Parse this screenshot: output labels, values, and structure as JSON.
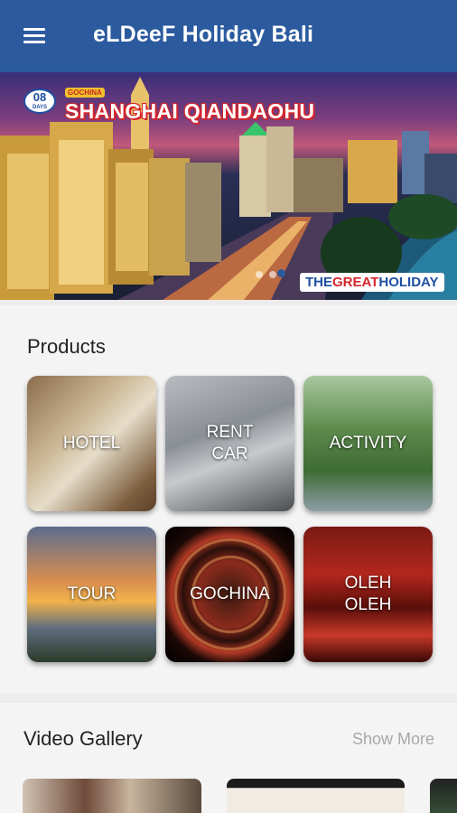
{
  "app_bar": {
    "title": "eLDeeF Holiday Bali",
    "menu_icon": "hamburger-menu-icon",
    "background": "#2b5a9e"
  },
  "banner": {
    "days_number": "08",
    "days_label": "DAYS",
    "tag": "GOCHINA",
    "headline": "SHANGHAI QIANDAOHU",
    "brand_prefix": "THE",
    "brand_highlight": "GREAT",
    "brand_suffix": "HOLIDAY"
  },
  "products": {
    "title": "Products",
    "items": [
      {
        "label": "HOTEL"
      },
      {
        "label": "RENT\nCAR"
      },
      {
        "label": "ACTIVITY"
      },
      {
        "label": "TOUR"
      },
      {
        "label": "GOCHINA"
      },
      {
        "label": "OLEH\nOLEH"
      }
    ]
  },
  "video_gallery": {
    "title": "Video Gallery",
    "show_more": "Show More"
  }
}
